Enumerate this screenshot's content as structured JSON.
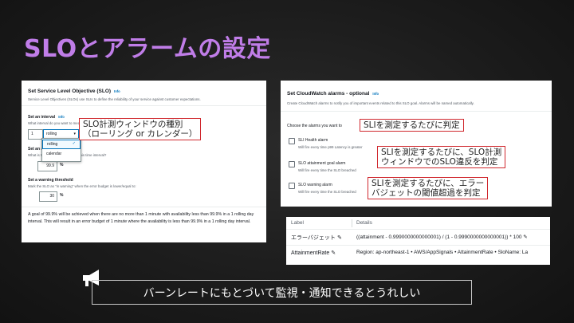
{
  "slide": {
    "title": "SLOとアラームの設定",
    "banner": "バーンレートにもとづいて監視・通知できるとうれしい"
  },
  "panel_slo": {
    "heading": "Set Service Level Objective (SLO)",
    "heading_info": "Info",
    "description": "Service Level Objectives (SLOs) use SLIs to define the reliability of your service against customer expectations.",
    "interval_label": "Set an interval",
    "interval_info": "Info",
    "interval_hint": "What interval do you want to measure against?",
    "interval_value": "1",
    "interval_unit_selected": "rolling",
    "dropdown_options": [
      "rolling",
      "calendar"
    ],
    "goal_label": "Set an attainment goal",
    "goal_hint": "What is the attainment goal over this time interval?",
    "goal_value": "99.9",
    "goal_unit": "%",
    "warning_label": "Set a warning threshold",
    "warning_hint": "Mark the SLO as \"in warning\" when the error budget is lower/equal to:",
    "warning_value": "30",
    "warning_unit": "%",
    "summary": "A goal of 99.9% will be achieved when there are no more than 1 minute with availability less than 99.9% in a 1 rolling day interval. This will result in an error budget of 1 minute where the availability is less than 99.9% in a 1 rolling day interval."
  },
  "panel_alarms": {
    "heading": "Set CloudWatch alarms - optional",
    "heading_info": "Info",
    "description": "Create CloudWatch alarms to notify you of important events related to this SLO goal. Alarms will be named automatically.",
    "choose_label": "Choose the alarms you want to",
    "options": [
      {
        "label": "SLI Health alarm",
        "hint": "Will fire every time p99 Latency is greater"
      },
      {
        "label": "SLO attainment goal alarm",
        "hint": "Will fire every time the SLO breached"
      },
      {
        "label": "SLO warning alarm",
        "hint": "Will fire every time the SLO breached"
      }
    ]
  },
  "panel_labels": {
    "header_label": "Label",
    "header_details": "Details",
    "rows": [
      {
        "label": "エラーバジェット",
        "details": "((attainment - 0.9990000000000001) / (1 - 0.9990000000000001)) * 100"
      },
      {
        "label": "AttainmentRate",
        "details": "Region: ap-northeast-1 • AWS/AppSignals • AttainmentRate • SloName: La"
      }
    ]
  },
  "callouts": {
    "interval_type": "SLO計測ウィンドウの種別\n（ローリング or カレンダー）",
    "health": "SLIを測定するたびに判定",
    "attainment": "SLIを測定するたびに、SLO計測\nウィンドウでのSLO違反を判定",
    "warning": "SLIを測定するたびに、エラー\nバジェットの閾値超過を判定"
  }
}
